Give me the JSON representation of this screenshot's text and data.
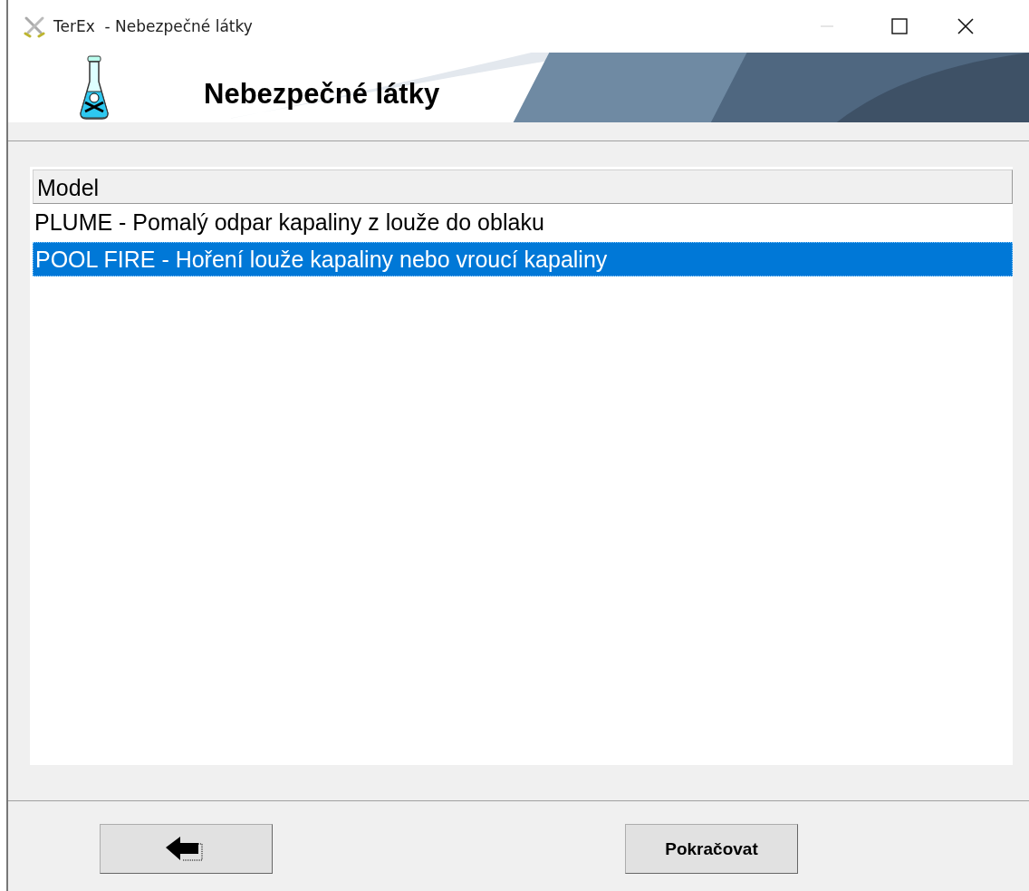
{
  "window": {
    "title": "TerEx  - Nebezpečné látky"
  },
  "banner": {
    "title": "Nebezpečné látky"
  },
  "list": {
    "columns": [
      "Model"
    ],
    "rows": [
      {
        "text": "PLUME - Pomalý odpar kapaliny z louže do oblaku",
        "selected": false
      },
      {
        "text": "POOL FIRE - Hoření louže kapaliny nebo vroucí kapaliny",
        "selected": true
      }
    ]
  },
  "buttons": [
    {
      "kind": "back"
    },
    {
      "kind": "text",
      "label": "Pokračovat"
    }
  ]
}
